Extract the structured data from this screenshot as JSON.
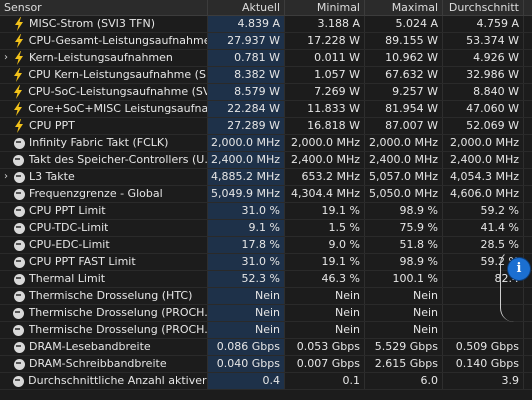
{
  "columns": {
    "sensor": "Sensor",
    "current": "Aktuell",
    "min": "Minimal",
    "max": "Maximal",
    "avg": "Durchschnitt"
  },
  "rows": [
    {
      "icon": "bolt",
      "name": "MISC-Strom (SVI3 TFN)",
      "cur": "4.839 A",
      "min": "3.188 A",
      "max": "5.024 A",
      "avg": "4.759 A"
    },
    {
      "icon": "bolt",
      "name": "CPU-Gesamt-Leistungsaufnahme",
      "cur": "27.937 W",
      "min": "17.228 W",
      "max": "89.155 W",
      "avg": "53.374 W"
    },
    {
      "icon": "bolt",
      "expand": true,
      "name": "Kern-Leistungsaufnahmen",
      "cur": "0.781 W",
      "min": "0.011 W",
      "max": "10.962 W",
      "avg": "4.926 W"
    },
    {
      "icon": "bolt",
      "name": "CPU Kern-Leistungsaufnahme (S...",
      "cur": "8.382 W",
      "min": "1.057 W",
      "max": "67.632 W",
      "avg": "32.986 W"
    },
    {
      "icon": "bolt",
      "name": "CPU-SoC-Leistungsaufnahme (SV...",
      "cur": "8.579 W",
      "min": "7.269 W",
      "max": "9.257 W",
      "avg": "8.840 W"
    },
    {
      "icon": "bolt",
      "name": "Core+SoC+MISC Leistungsaufna...",
      "cur": "22.284 W",
      "min": "11.833 W",
      "max": "81.954 W",
      "avg": "47.060 W"
    },
    {
      "icon": "bolt",
      "name": "CPU PPT",
      "cur": "27.289 W",
      "min": "16.818 W",
      "max": "87.007 W",
      "avg": "52.069 W"
    },
    {
      "icon": "clock",
      "name": "Infinity Fabric Takt (FCLK)",
      "cur": "2,000.0 MHz",
      "min": "2,000.0 MHz",
      "max": "2,000.0 MHz",
      "avg": "2,000.0 MHz"
    },
    {
      "icon": "clock",
      "name": "Takt des Speicher-Controllers (U...",
      "cur": "2,400.0 MHz",
      "min": "2,400.0 MHz",
      "max": "2,400.0 MHz",
      "avg": "2,400.0 MHz"
    },
    {
      "icon": "clock",
      "expand": true,
      "name": "L3 Takte",
      "cur": "4,885.2 MHz",
      "min": "653.2 MHz",
      "max": "5,057.0 MHz",
      "avg": "4,054.3 MHz"
    },
    {
      "icon": "clock",
      "name": "Frequenzgrenze - Global",
      "cur": "5,049.9 MHz",
      "min": "4,304.4 MHz",
      "max": "5,050.0 MHz",
      "avg": "4,606.0 MHz"
    },
    {
      "icon": "clock",
      "name": "CPU PPT Limit",
      "cur": "31.0 %",
      "min": "19.1 %",
      "max": "98.9 %",
      "avg": "59.2 %"
    },
    {
      "icon": "clock",
      "name": "CPU-TDC-Limit",
      "cur": "9.1 %",
      "min": "1.5 %",
      "max": "75.9 %",
      "avg": "41.4 %"
    },
    {
      "icon": "clock",
      "name": "CPU-EDC-Limit",
      "cur": "17.8 %",
      "min": "9.0 %",
      "max": "51.8 %",
      "avg": "28.5 %"
    },
    {
      "icon": "clock",
      "name": "CPU PPT FAST Limit",
      "cur": "31.0 %",
      "min": "19.1 %",
      "max": "98.9 %",
      "avg": "59.2 %"
    },
    {
      "icon": "clock",
      "name": "Thermal Limit",
      "cur": "52.3 %",
      "min": "46.3 %",
      "max": "100.1 %",
      "avg": "82.4"
    },
    {
      "icon": "clock",
      "name": "Thermische Drosselung (HTC)",
      "cur": "Nein",
      "min": "Nein",
      "max": "Nein",
      "avg": ""
    },
    {
      "icon": "clock",
      "name": "Thermische Drosselung (PROCH...",
      "cur": "Nein",
      "min": "Nein",
      "max": "Nein",
      "avg": ""
    },
    {
      "icon": "clock",
      "name": "Thermische Drosselung (PROCH...",
      "cur": "Nein",
      "min": "Nein",
      "max": "Nein",
      "avg": ""
    },
    {
      "icon": "clock",
      "name": "DRAM-Lesebandbreite",
      "cur": "0.086 Gbps",
      "min": "0.053 Gbps",
      "max": "5.529 Gbps",
      "avg": "0.509 Gbps"
    },
    {
      "icon": "clock",
      "name": "DRAM-Schreibbandbreite",
      "cur": "0.040 Gbps",
      "min": "0.007 Gbps",
      "max": "2.615 Gbps",
      "avg": "0.140 Gbps"
    },
    {
      "icon": "clock",
      "name": "Durchschnittliche Anzahl aktiver ...",
      "cur": "0.4",
      "min": "0.1",
      "max": "6.0",
      "avg": "3.9"
    }
  ],
  "info_button": {
    "label": "i"
  },
  "colors": {
    "bolt": "#f2c21a",
    "current_bg": "#1e3149",
    "info": "#1b6fd1"
  }
}
